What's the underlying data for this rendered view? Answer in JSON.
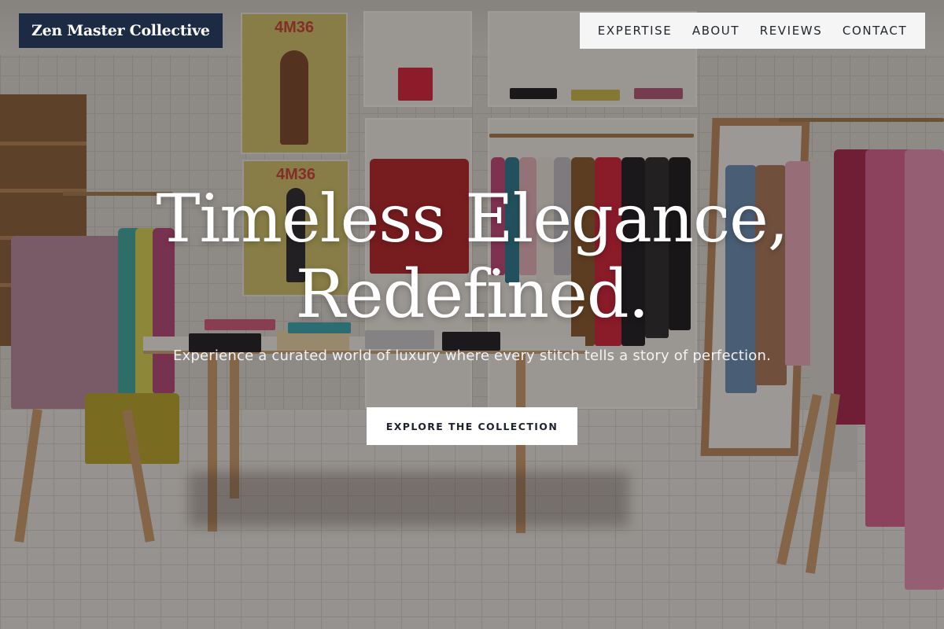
{
  "brand": {
    "name": "Zen Master Collective"
  },
  "nav": {
    "items": [
      {
        "label": "EXPERTISE"
      },
      {
        "label": "ABOUT"
      },
      {
        "label": "REVIEWS"
      },
      {
        "label": "CONTACT"
      }
    ]
  },
  "hero": {
    "title_line1": "Timeless Elegance,",
    "title_line2": "Redefined.",
    "subtitle": "Experience a curated world of luxury where every stitch tells a story of perfection.",
    "cta_label": "EXPLORE THE COLLECTION"
  },
  "background": {
    "poster_top_text": "4M36",
    "poster_bottom_text": "4M36"
  },
  "colors": {
    "brand_bg": "#1d2a44",
    "nav_bg": "#f5f5f5",
    "cta_bg": "#ffffff"
  }
}
